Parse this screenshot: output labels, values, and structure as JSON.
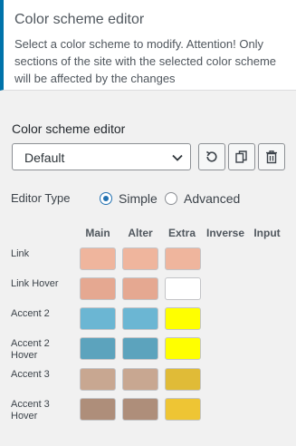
{
  "header": {
    "title": "Color scheme editor",
    "description": "Select a color scheme to modify. Attention! Only sections of the site with the selected color scheme will be affected by the changes"
  },
  "editor": {
    "section_title": "Color scheme editor",
    "scheme_select": {
      "selected": "Default",
      "icon": "chevron-down-icon"
    },
    "actions": [
      {
        "name": "reset",
        "icon": "reset-icon"
      },
      {
        "name": "copy",
        "icon": "copy-icon"
      },
      {
        "name": "delete",
        "icon": "trash-icon"
      }
    ],
    "editor_type": {
      "label": "Editor Type",
      "options": [
        {
          "label": "Simple",
          "checked": true
        },
        {
          "label": "Advanced",
          "checked": false
        }
      ]
    }
  },
  "columns": [
    "Main",
    "Alter",
    "Extra",
    "Inverse",
    "Input"
  ],
  "rows": [
    {
      "label": "Link",
      "colors": [
        "#efb59d",
        "#efb59d",
        "#efb59d"
      ]
    },
    {
      "label": "Link Hover",
      "colors": [
        "#e5a891",
        "#e5a891",
        "#ffffff"
      ]
    },
    {
      "label": "Accent 2",
      "colors": [
        "#6bb6d3",
        "#6bb6d3",
        "#ffff00"
      ]
    },
    {
      "label": "Accent 2 Hover",
      "colors": [
        "#5ca3bd",
        "#5ca3bd",
        "#ffff00"
      ]
    },
    {
      "label": "Accent 3",
      "colors": [
        "#c8a791",
        "#c8a791",
        "#e0bb37"
      ]
    },
    {
      "label": "Accent 3 Hover",
      "colors": [
        "#ae8e7a",
        "#ae8e7a",
        "#eec534"
      ]
    }
  ],
  "colors": {
    "accent": "#0073aa",
    "radio_accent": "#2271b1"
  }
}
